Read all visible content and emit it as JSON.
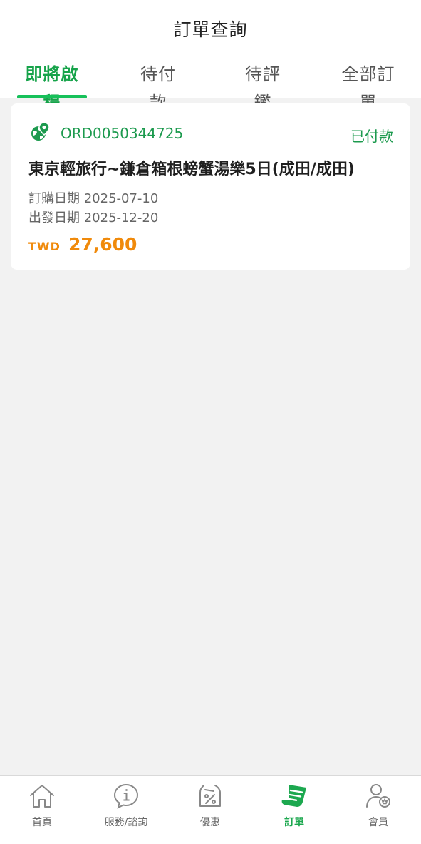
{
  "header": {
    "title": "訂單查詢",
    "tabs": [
      {
        "label": "即將啟程",
        "active": true
      },
      {
        "label": "待付款",
        "active": false
      },
      {
        "label": "待評鑑",
        "active": false
      },
      {
        "label": "全部訂單",
        "active": false
      }
    ]
  },
  "orders": [
    {
      "order_no": "ORD0050344725",
      "status": "已付款",
      "title": "東京輕旅行~鎌倉箱根螃蟹湯樂5日(成田/成田)",
      "order_date": "訂購日期 2025-07-10",
      "depart_date": "出發日期 2025-12-20",
      "currency": "TWD",
      "amount": "27,600",
      "icon": "globe-pin-icon"
    }
  ],
  "bottom_nav": [
    {
      "label": "首頁",
      "icon": "home-icon",
      "active": false
    },
    {
      "label": "服務/諮詢",
      "icon": "info-icon",
      "active": false
    },
    {
      "label": "優惠",
      "icon": "discount-tag-icon",
      "active": false
    },
    {
      "label": "訂單",
      "icon": "order-icon",
      "active": true
    },
    {
      "label": "會員",
      "icon": "member-icon",
      "active": false
    }
  ],
  "colors": {
    "accent_green": "#16a34a",
    "price_orange": "#f08a0b",
    "background": "#f2f2f2"
  }
}
